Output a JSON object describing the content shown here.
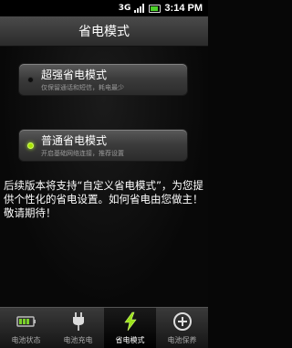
{
  "status_bar": {
    "network": "3G",
    "time": "3:14 PM"
  },
  "title": "省电模式",
  "modes": [
    {
      "title": "超强省电模式",
      "subtitle": "仅保留通话和短信，耗电最少",
      "selected": false
    },
    {
      "title": "普通省电模式",
      "subtitle": "开启基础网络连接，推荐设置",
      "selected": true
    }
  ],
  "note": "后续版本将支持“自定义省电模式”，为您提供个性化的省电设置。如何省电由您做主！敬请期待！",
  "tabs": [
    {
      "label": "电池状态",
      "icon": "battery-icon",
      "active": false
    },
    {
      "label": "电池充电",
      "icon": "plug-icon",
      "active": false
    },
    {
      "label": "省电模式",
      "icon": "lightning-icon",
      "active": true
    },
    {
      "label": "电池保养",
      "icon": "plus-circle-icon",
      "active": false
    }
  ],
  "colors": {
    "accent_green": "#9be21a",
    "background": "#070707"
  }
}
